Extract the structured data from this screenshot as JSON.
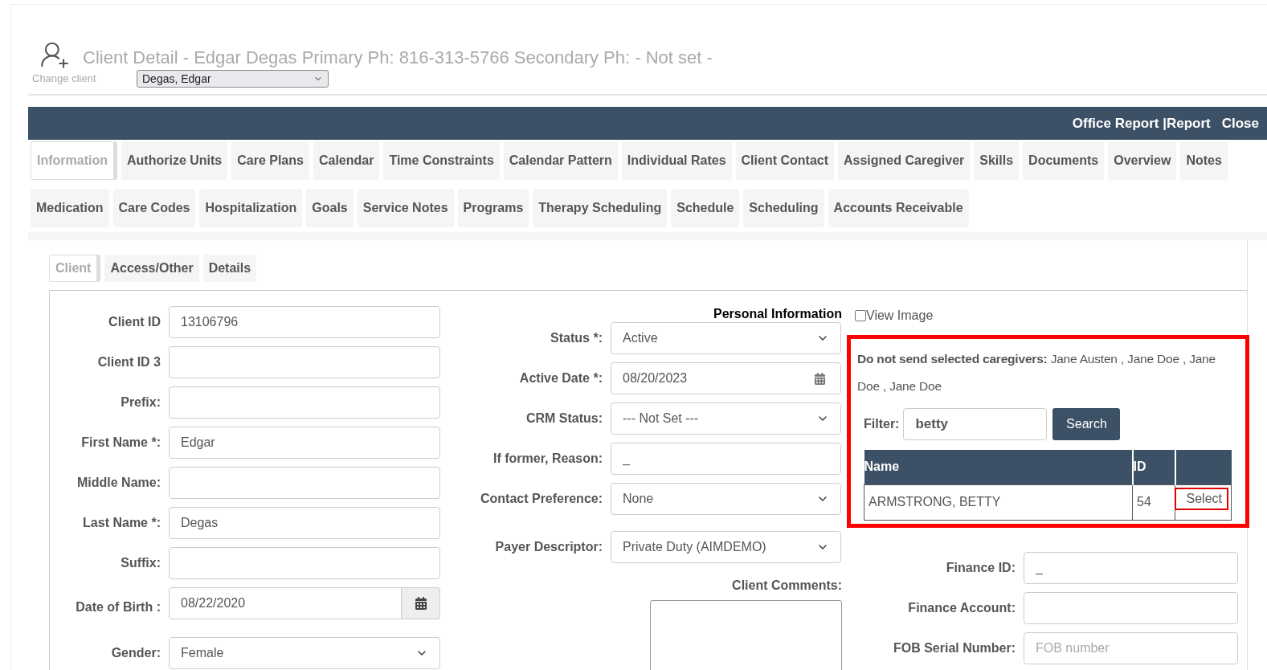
{
  "header": {
    "title": "Client Detail - Edgar Degas Primary Ph: 816-313-5766 Secondary Ph: - Not set -",
    "change_client_label": "Change client",
    "client_select": "Degas, Edgar"
  },
  "toolbar": {
    "links": [
      "Office Report |Report",
      "Close"
    ]
  },
  "tab_rows": [
    [
      {
        "label": "Information",
        "selected": true
      },
      {
        "label": "Authorize Units",
        "selected": false
      },
      {
        "label": "Care Plans",
        "selected": false
      },
      {
        "label": "Calendar",
        "selected": false
      },
      {
        "label": "Time Constraints",
        "selected": false
      },
      {
        "label": "Calendar Pattern",
        "selected": false
      },
      {
        "label": "Individual Rates",
        "selected": false
      },
      {
        "label": "Client Contact",
        "selected": false
      },
      {
        "label": "Assigned Caregiver",
        "selected": false
      },
      {
        "label": "Skills",
        "selected": false
      },
      {
        "label": "Documents",
        "selected": false
      },
      {
        "label": "Overview",
        "selected": false
      },
      {
        "label": "Notes",
        "selected": false
      }
    ],
    [
      {
        "label": "Medication",
        "selected": false
      },
      {
        "label": "Care Codes",
        "selected": false
      },
      {
        "label": "Hospitalization",
        "selected": false
      },
      {
        "label": "Goals",
        "selected": false
      },
      {
        "label": "Service Notes",
        "selected": false
      },
      {
        "label": "Programs",
        "selected": false
      },
      {
        "label": "Therapy Scheduling",
        "selected": false
      },
      {
        "label": "Schedule",
        "selected": false
      },
      {
        "label": "Scheduling",
        "selected": false
      },
      {
        "label": "Accounts Receivable",
        "selected": false
      }
    ]
  ],
  "subtabs": [
    {
      "label": "Client",
      "selected": true
    },
    {
      "label": "Access/Other",
      "selected": false
    },
    {
      "label": "Details",
      "selected": false
    }
  ],
  "left_fields": [
    {
      "label": "Client ID",
      "kind": "text",
      "value": "13106796"
    },
    {
      "label": "Client ID 3",
      "kind": "text"
    },
    {
      "label": "Prefix:",
      "kind": "text"
    },
    {
      "label": "First Name *:",
      "kind": "text",
      "value": "Edgar"
    },
    {
      "label": "Middle Name:",
      "kind": "text"
    },
    {
      "label": "Last Name *:",
      "kind": "text",
      "value": "Degas"
    },
    {
      "label": "Suffix:",
      "kind": "text"
    },
    {
      "label": "Date of Birth :",
      "kind": "date_addon",
      "value": "08/22/2020"
    },
    {
      "label": "Gender:",
      "kind": "select",
      "value": "Female"
    }
  ],
  "personal_heading": "Personal Information",
  "middle_fields": [
    {
      "label": "Status *:",
      "kind": "select",
      "value": "Active"
    },
    {
      "label": "Active Date *:",
      "kind": "date",
      "value": "08/20/2023"
    },
    {
      "label": "CRM Status:",
      "kind": "select",
      "value": "--- Not Set ---"
    },
    {
      "label": "If former, Reason:",
      "kind": "text",
      "value": "_"
    },
    {
      "label": "Contact Preference:",
      "kind": "select",
      "value": "None"
    },
    {
      "label": "Payer Descriptor:",
      "kind": "select",
      "value": "Private Duty (AIMDEMO)"
    }
  ],
  "comments_label": "Client Comments:",
  "view_image": {
    "label": "View Image",
    "checked": false
  },
  "caregivers": {
    "excluded_text": "**Do not send selected caregivers:** Jane Austen , Jane Doe , Jane Doe , Jane Doe",
    "filter_label": "Filter:",
    "filter_value": "betty",
    "search_button": "Search",
    "columns": [
      "Name",
      "ID"
    ],
    "rows": [
      {
        "name": "ARMSTRONG, BETTY",
        "id": "54",
        "action": "Select"
      }
    ]
  },
  "right_fields": [
    {
      "label": "Finance ID:",
      "value": "_"
    },
    {
      "label": "Finance Account:"
    },
    {
      "label": "FOB Serial Number:",
      "placeholder": "FOB number"
    }
  ]
}
